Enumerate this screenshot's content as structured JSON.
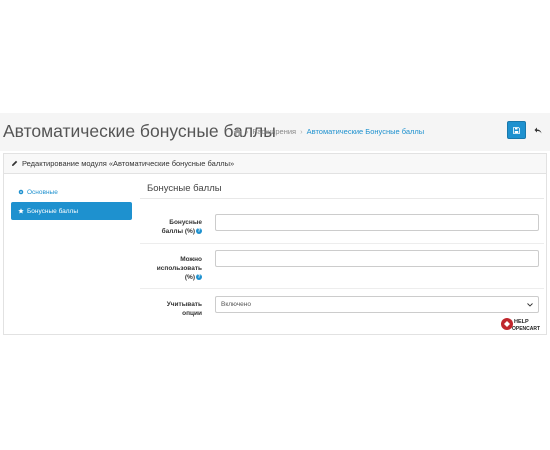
{
  "header": {
    "title": "Автоматические бонусные баллы",
    "breadcrumb": {
      "home_icon": "home-icon",
      "items": [
        "Расширения",
        "Автоматические Бонусные баллы"
      ]
    },
    "save_icon": "floppy-disk-icon",
    "back_icon": "reply-arrow-icon"
  },
  "panel": {
    "heading_icon": "pencil-icon",
    "heading": "Редактирование модуля «Автоматические бонусные баллы»"
  },
  "nav": {
    "items": [
      {
        "label": "Основные",
        "icon": "gear-icon"
      },
      {
        "label": "Бонусные баллы",
        "icon": "star-icon",
        "active": true
      }
    ]
  },
  "form": {
    "section_title": "Бонусные баллы",
    "fields": [
      {
        "label_line1": "Бонусные",
        "label_line2": "баллы (%)",
        "value": ""
      },
      {
        "label_line1": "Можно",
        "label_line2": "использовать",
        "label_line3": "(%)",
        "value": ""
      },
      {
        "label_line1": "Учитывать",
        "label_line2": "опции",
        "selected": "Включено"
      }
    ]
  },
  "watermark": {
    "line1": "HELP",
    "line2": "OPENCART"
  },
  "colors": {
    "primary": "#1e91cf",
    "header_bg": "#f5f5f5"
  }
}
